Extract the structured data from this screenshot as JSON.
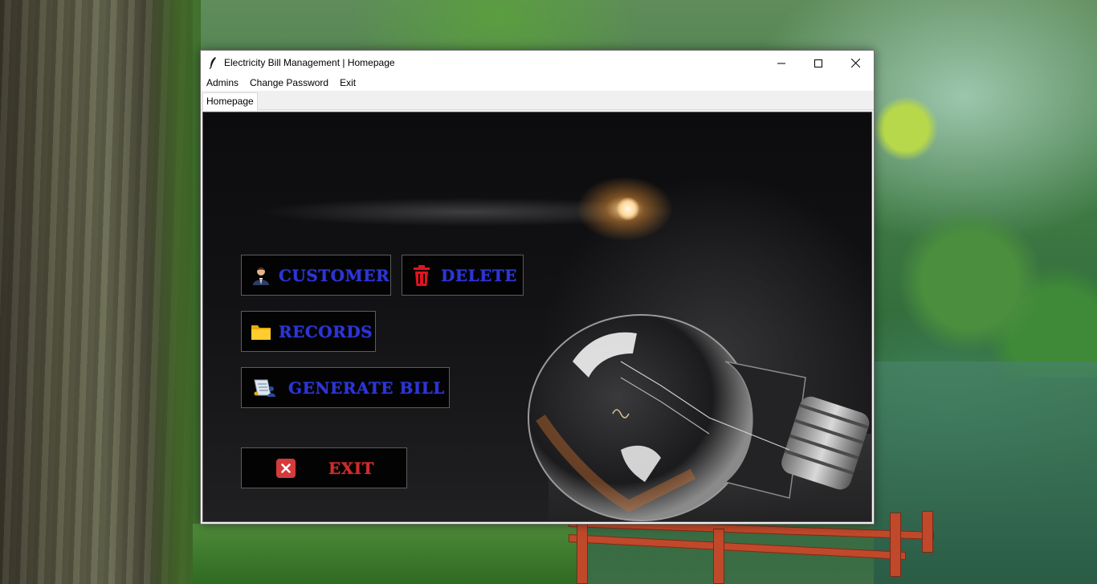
{
  "window": {
    "title": "Electricity Bill Management | Homepage",
    "controls": [
      "minimize-icon",
      "maximize-icon",
      "close-icon"
    ]
  },
  "menu": {
    "items": [
      "Admins",
      "Change Password",
      "Exit"
    ]
  },
  "tabs": [
    {
      "label": "Homepage",
      "active": true
    }
  ],
  "buttons": {
    "customer": {
      "label": "CUSTOMER",
      "icon": "user-icon"
    },
    "delete": {
      "label": "DELETE",
      "icon": "trash-icon"
    },
    "records": {
      "label": "RECORDS",
      "icon": "folder-icon"
    },
    "generate_bill": {
      "label": "GENERATE BILL",
      "icon": "bill-icon"
    },
    "exit": {
      "label": "EXIT",
      "icon": "close-box-icon"
    }
  },
  "colors": {
    "button_text": "#2d35d6",
    "exit_text": "#d12b2b",
    "button_bg": "#030303"
  }
}
